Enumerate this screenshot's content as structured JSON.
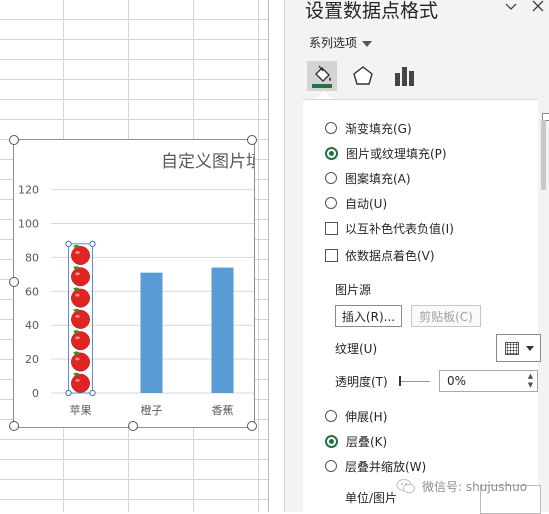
{
  "chart_data": {
    "type": "bar",
    "title": "自定义图片填",
    "categories": [
      "苹果",
      "橙子",
      "香蕉"
    ],
    "values": [
      88,
      71,
      74
    ],
    "ylim": [
      0,
      120
    ],
    "yticks": [
      0,
      20,
      40,
      60,
      80,
      100,
      120
    ],
    "bar_color": "#5b9bd5",
    "selected_point_fill": "apple-picture-stacked",
    "grid": true
  },
  "pane": {
    "title": "设置数据点格式",
    "series_options": "系列选项",
    "tabs": [
      {
        "name": "fill-line",
        "icon": "paint-bucket-icon",
        "active": true
      },
      {
        "name": "effects",
        "icon": "pentagon-icon",
        "active": false
      },
      {
        "name": "series-options",
        "icon": "bar-chart-icon",
        "active": false
      }
    ],
    "fill_options": [
      {
        "label": "渐变填充(G)",
        "selected": false
      },
      {
        "label": "图片或纹理填充(P)",
        "selected": true
      },
      {
        "label": "图案填充(A)",
        "selected": false
      },
      {
        "label": "自动(U)",
        "selected": false
      }
    ],
    "checkboxes": [
      {
        "label": "以互补色代表负值(I)",
        "checked": false
      },
      {
        "label": "依数据点着色(V)",
        "checked": false
      }
    ],
    "picture_source": "图片源",
    "insert_button": "插入(R)...",
    "clipboard_button": "剪贴板(C)",
    "texture_label": "纹理(U)",
    "transparency_label": "透明度(T)",
    "transparency_value": "0%",
    "transparency_level": 0,
    "layout_options": [
      {
        "label": "伸展(H)",
        "selected": false
      },
      {
        "label": "层叠(K)",
        "selected": true
      },
      {
        "label": "层叠并缩放(W)",
        "selected": false
      }
    ],
    "unit_label": "单位/图片",
    "accent_color": "#217346"
  },
  "watermark": {
    "text": "微信号: shujushuo"
  }
}
